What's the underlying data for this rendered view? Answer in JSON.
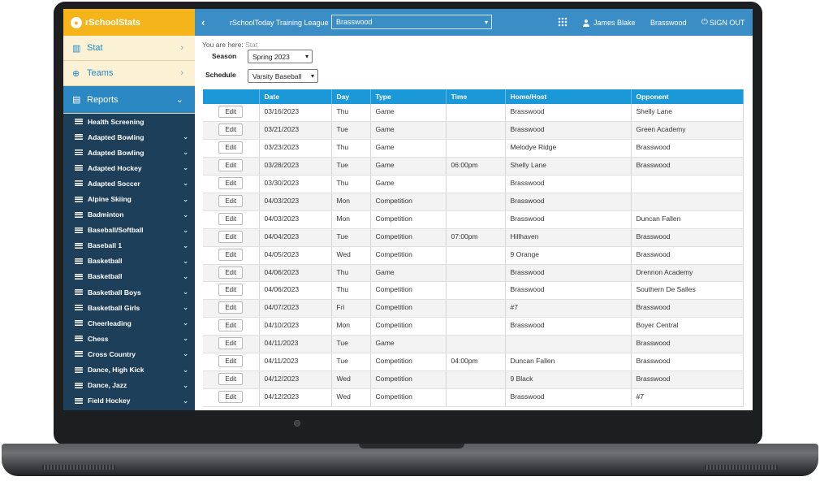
{
  "brand": {
    "name": "rSchoolStats"
  },
  "nav": [
    {
      "label": "Stat",
      "icon": "bar-chart-icon",
      "active": false
    },
    {
      "label": "Teams",
      "icon": "globe-icon",
      "active": false
    },
    {
      "label": "Reports",
      "icon": "document-icon",
      "active": true
    }
  ],
  "sports": [
    "Health Screening",
    "Adapted Bowling",
    "Adapted Bowling",
    "Adapted Hockey",
    "Adapted Soccer",
    "Alpine Skiing",
    "Badminton",
    "Baseball/Softball",
    "Baseball 1",
    "Basketball",
    "Basketball",
    "Basketball Boys",
    "Basketball Girls",
    "Cheerleading",
    "Chess",
    "Cross Country",
    "Dance, High Kick",
    "Dance, Jazz",
    "Field Hockey"
  ],
  "topbar": {
    "league": "rSchoolToday Training League",
    "school": "Brasswood",
    "user": "James Blake",
    "org": "Brasswood",
    "signout": "SIGN OUT"
  },
  "content": {
    "crumb_prefix": "You are here:",
    "crumb_current": "Stat",
    "season_label": "Season",
    "season_value": "Spring 2023",
    "schedule_label": "Schedule",
    "schedule_value": "Varsity Baseball"
  },
  "table": {
    "headers": [
      "",
      "Date",
      "Day",
      "Type",
      "Time",
      "Home/Host",
      "Opponent"
    ],
    "edit_label": "Edit",
    "rows": [
      [
        "03/16/2023",
        "Thu",
        "Game",
        "",
        "Brasswood",
        "Shelly Lane"
      ],
      [
        "03/21/2023",
        "Tue",
        "Game",
        "",
        "Brasswood",
        "Green Academy"
      ],
      [
        "03/23/2023",
        "Thu",
        "Game",
        "",
        "Melodye Ridge",
        "Brasswood"
      ],
      [
        "03/28/2023",
        "Tue",
        "Game",
        "06:00pm",
        "Shelly Lane",
        "Brasswood"
      ],
      [
        "03/30/2023",
        "Thu",
        "Game",
        "",
        "Brasswood",
        ""
      ],
      [
        "04/03/2023",
        "Mon",
        "Competition",
        "",
        "Brasswood",
        ""
      ],
      [
        "04/03/2023",
        "Mon",
        "Competition",
        "",
        "Brasswood",
        "Duncan Fallen"
      ],
      [
        "04/04/2023",
        "Tue",
        "Competition",
        "07:00pm",
        "Hillhaven",
        "Brasswood"
      ],
      [
        "04/05/2023",
        "Wed",
        "Competition",
        "",
        "9 Orange",
        "Brasswood"
      ],
      [
        "04/06/2023",
        "Thu",
        "Game",
        "",
        "Brasswood",
        "Drennon Academy"
      ],
      [
        "04/06/2023",
        "Thu",
        "Competition",
        "",
        "Brasswood",
        "Southern De Salles"
      ],
      [
        "04/07/2023",
        "Fri",
        "Competition",
        "",
        "#7",
        "Brasswood"
      ],
      [
        "04/10/2023",
        "Mon",
        "Competition",
        "",
        "Brasswood",
        "Boyer Central"
      ],
      [
        "04/11/2023",
        "Tue",
        "Game",
        "",
        "",
        "Brasswood"
      ],
      [
        "04/11/2023",
        "Tue",
        "Competition",
        "04:00pm",
        "Duncan Fallen",
        "Brasswood"
      ],
      [
        "04/12/2023",
        "Wed",
        "Competition",
        "",
        "9 Black",
        "Brasswood"
      ],
      [
        "04/12/2023",
        "Wed",
        "Competition",
        "",
        "Brasswood",
        "#7"
      ]
    ]
  },
  "colors": {
    "brand_yellow": "#f4b41a",
    "topbar_blue": "#3b8dc5",
    "header_blue": "#1a98d8",
    "sidebar_navy": "#1e3f5a"
  }
}
